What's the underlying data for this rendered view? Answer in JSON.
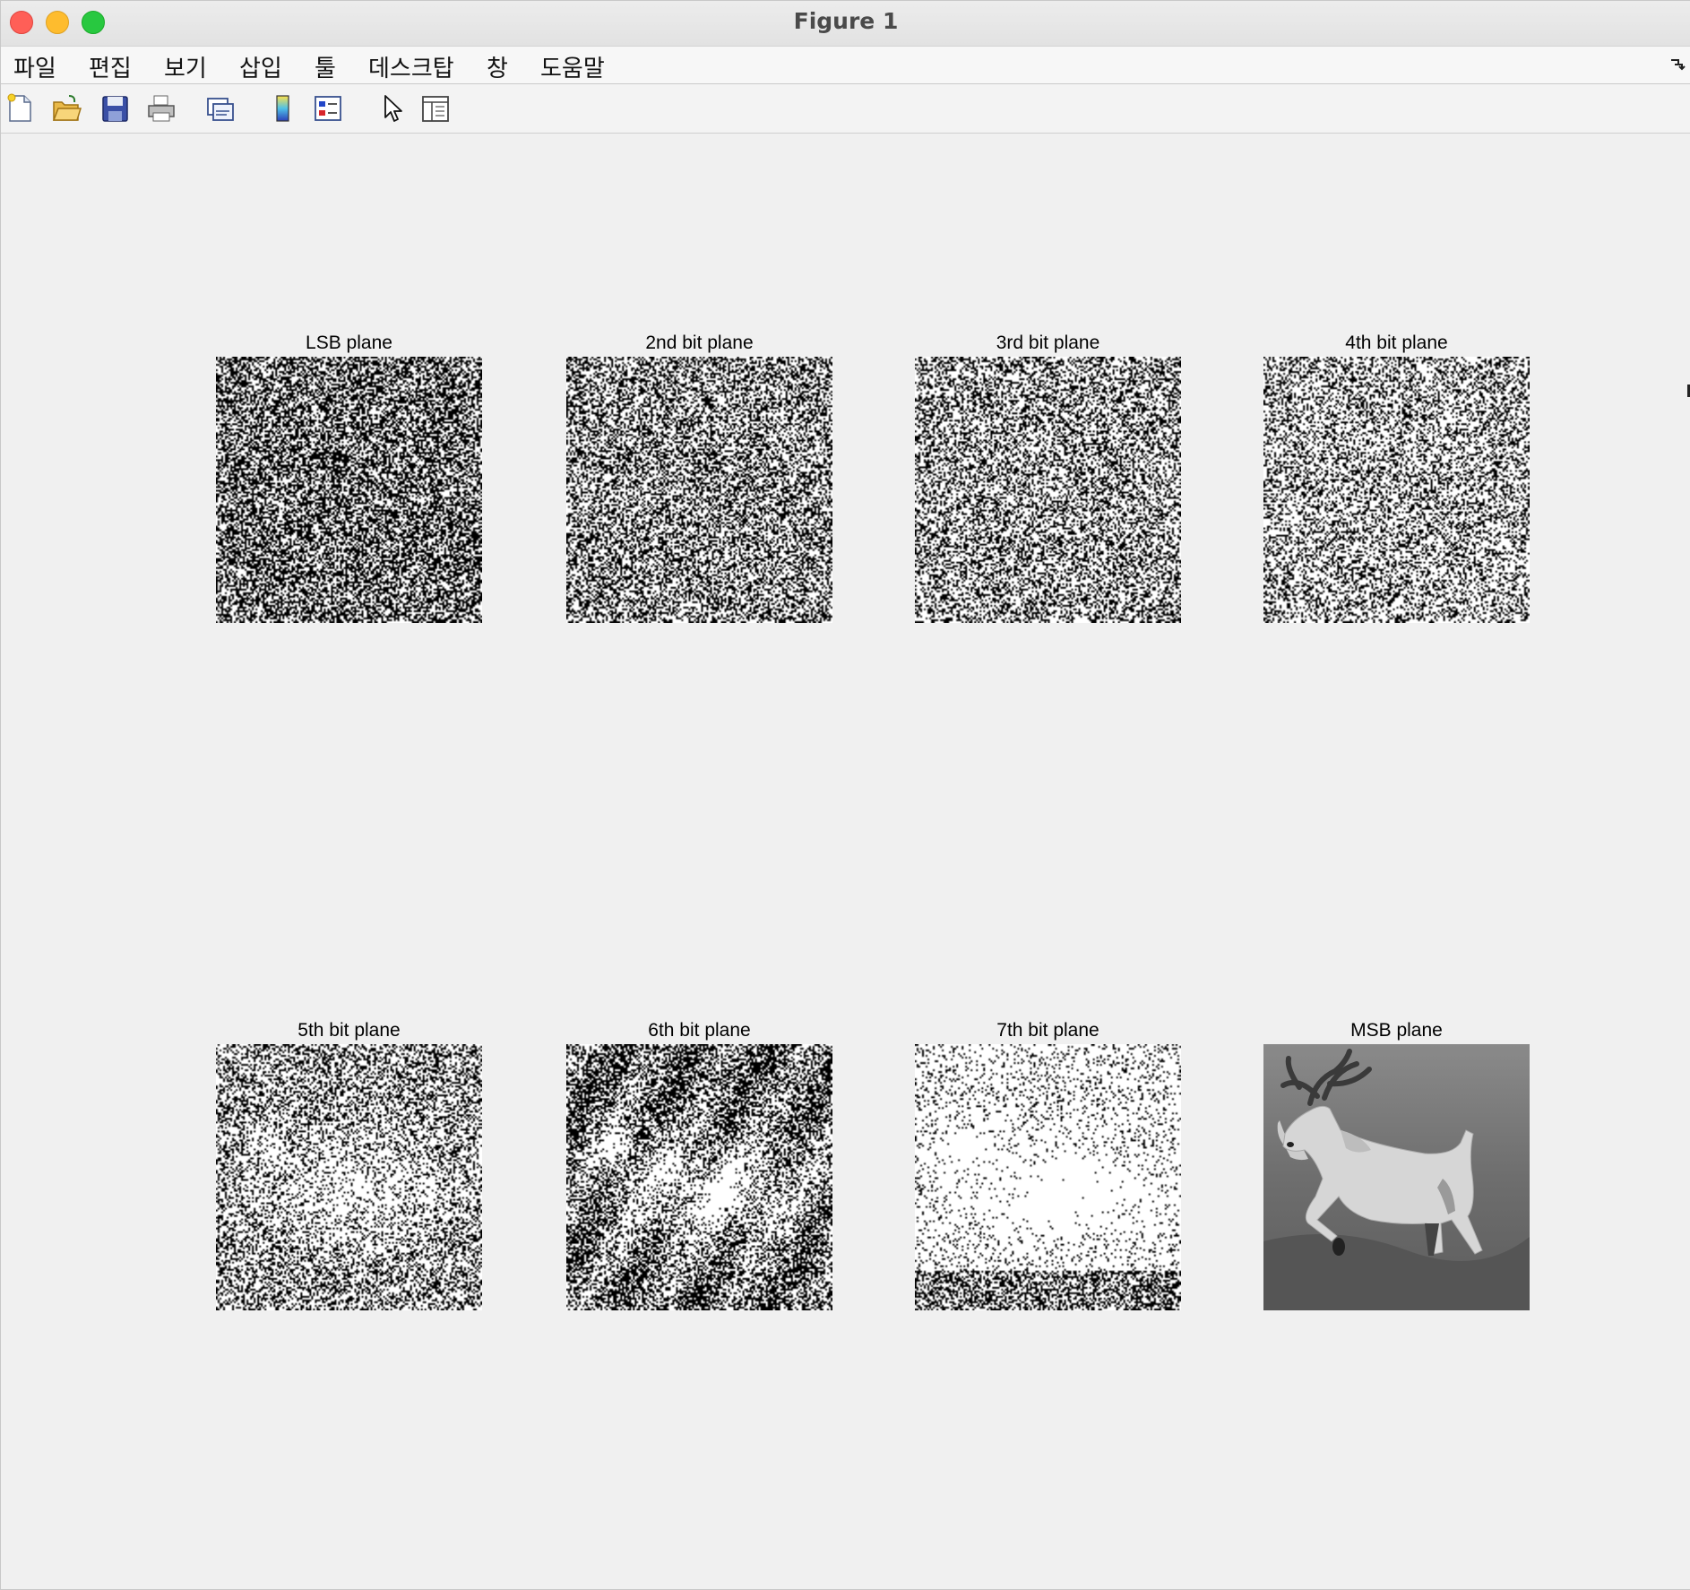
{
  "window": {
    "title": "Figure 1"
  },
  "menubar": {
    "items": [
      "파일",
      "편집",
      "보기",
      "삽입",
      "툴",
      "데스크탑",
      "창",
      "도움말"
    ]
  },
  "toolbar": {
    "buttons": [
      {
        "icon": "new-figure-icon"
      },
      {
        "icon": "open-file-icon"
      },
      {
        "icon": "save-icon"
      },
      {
        "icon": "print-icon"
      },
      {
        "icon": "link-figure-icon"
      },
      {
        "icon": "insert-colorbar-icon"
      },
      {
        "icon": "insert-legend-icon"
      },
      {
        "icon": "edit-plot-pointer-icon"
      },
      {
        "icon": "property-inspector-icon"
      }
    ]
  },
  "subplots": [
    {
      "title": "LSB plane",
      "bit": 0,
      "fraction_white": 0.45
    },
    {
      "title": "2nd bit plane",
      "bit": 1,
      "fraction_white": 0.55
    },
    {
      "title": "3rd bit plane",
      "bit": 2,
      "fraction_white": 0.6
    },
    {
      "title": "4th bit plane",
      "bit": 3,
      "fraction_white": 0.65
    },
    {
      "title": "5th bit plane",
      "bit": 4,
      "fraction_white": 0.6
    },
    {
      "title": "6th bit plane",
      "bit": 5,
      "fraction_white": 0.5
    },
    {
      "title": "7th bit plane",
      "bit": 6,
      "fraction_white": 0.92
    },
    {
      "title": "MSB plane",
      "bit": 7,
      "fraction_white": 0.0
    }
  ]
}
